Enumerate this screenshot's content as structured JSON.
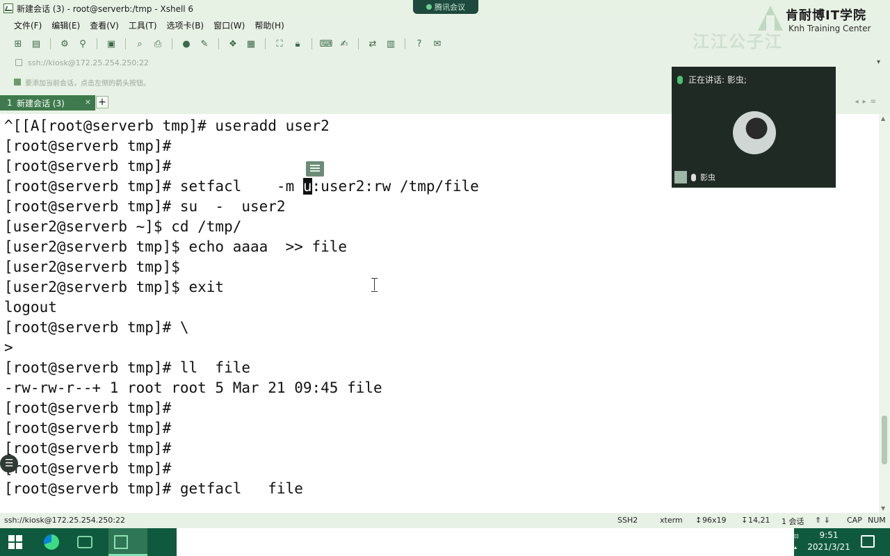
{
  "window": {
    "title": "新建会话 (3) - root@serverb:/tmp - Xshell 6",
    "meeting_chip": "腾讯会议"
  },
  "brand": {
    "name_cn": "肯耐博IT学院",
    "name_en": "Knh Training Center",
    "watermark": "江江公子江"
  },
  "menu": {
    "items": [
      "文件(F)",
      "编辑(E)",
      "查看(V)",
      "工具(T)",
      "选项卡(B)",
      "窗口(W)",
      "帮助(H)"
    ]
  },
  "toolbar": {
    "icons": [
      "new-session-icon",
      "open-icon",
      "reconnect-icon",
      "disconnect-icon",
      "properties-icon",
      "find-icon",
      "print-icon",
      "globe-icon",
      "color-icon",
      "refresh-icon",
      "sftp-icon",
      "fullscreen-icon",
      "lock-icon",
      "keyboard-icon",
      "compose-icon",
      "transfer-icon",
      "layout-icon",
      "help-icon",
      "chat-icon"
    ]
  },
  "address": {
    "value": "ssh://kiosk@172.25.254.250:22"
  },
  "hint": {
    "text": "要添加当前会话，点击左侧的箭头按钮。"
  },
  "tabs": [
    {
      "index": "1",
      "label": "新建会话 (3)",
      "close": "×"
    }
  ],
  "tab_add": "+",
  "terminal": {
    "lines": [
      "^[[A[root@serverb tmp]# useradd user2",
      "[root@serverb tmp]#",
      "[root@serverb tmp]#",
      "[root@serverb tmp]# setfacl    -m ",
      "[root@serverb tmp]# su  -  user2",
      "[user2@serverb ~]$ cd /tmp/",
      "[user2@serverb tmp]$ echo aaaa  >> file",
      "[user2@serverb tmp]$",
      "[user2@serverb tmp]$ exit",
      "logout",
      "[root@serverb tmp]# \\",
      ">",
      "[root@serverb tmp]# ll  file",
      "-rw-rw-r--+ 1 root root 5 Mar 21 09:45 file",
      "[root@serverb tmp]#",
      "[root@serverb tmp]#",
      "[root@serverb tmp]#",
      "[root@serverb tmp]#",
      "[root@serverb tmp]# getfacl   file"
    ],
    "cursor_char": "u",
    "after_cursor": ":user2:rw /tmp/file"
  },
  "video": {
    "speaking_label": "正在讲话: 影虫;",
    "participant": "影虫"
  },
  "status": {
    "connection": "ssh://kiosk@172.25.254.250:22",
    "protocol": "SSH2",
    "terminal_type": "xterm",
    "size": "96x19",
    "cursor_pos": "14,21",
    "sessions": "1 会话",
    "caps": "CAP",
    "num": "NUM"
  },
  "taskbar": {
    "time": "9:51",
    "date": "2021/3/21"
  }
}
